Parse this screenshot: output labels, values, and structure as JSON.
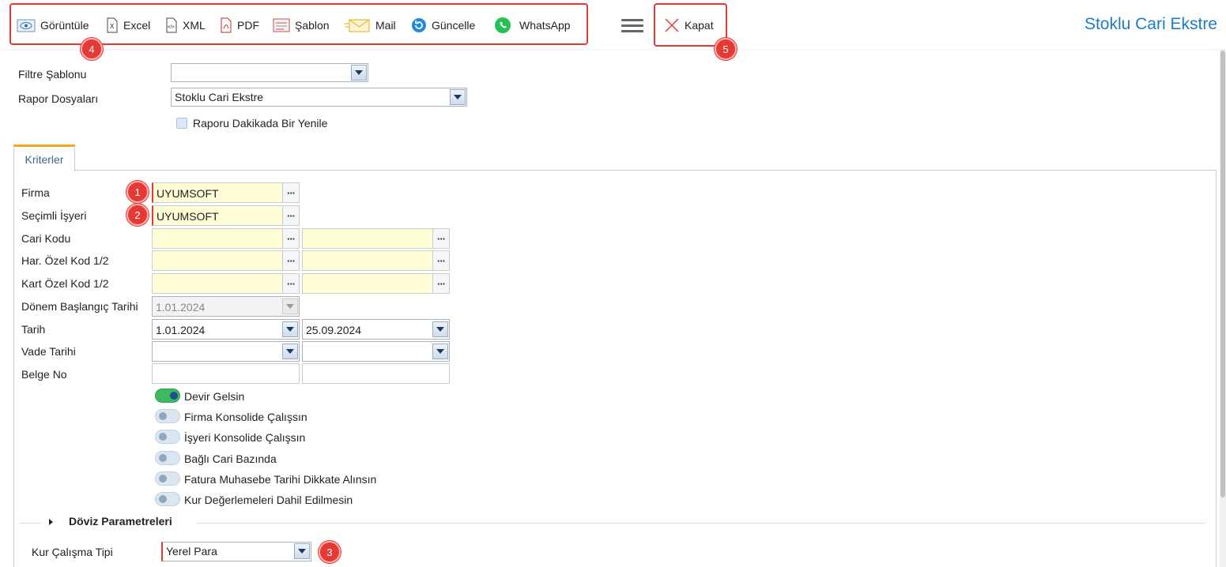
{
  "toolbar": {
    "buttons": [
      {
        "label": "Görüntüle",
        "icon": "view-icon"
      },
      {
        "label": "Excel",
        "icon": "excel-icon"
      },
      {
        "label": "XML",
        "icon": "xml-icon"
      },
      {
        "label": "PDF",
        "icon": "pdf-icon"
      },
      {
        "label": "Şablon",
        "icon": "template-icon"
      },
      {
        "label": "Mail",
        "icon": "mail-icon"
      },
      {
        "label": "Güncelle",
        "icon": "refresh-icon"
      },
      {
        "label": "WhatsApp",
        "icon": "whatsapp-icon"
      }
    ],
    "close_label": "Kapat",
    "page_title": "Stoklu Cari Ekstre"
  },
  "badges": [
    "1",
    "2",
    "3",
    "4",
    "5"
  ],
  "top_form": {
    "filter_template_label": "Filtre Şablonu",
    "filter_template_value": "",
    "report_files_label": "Rapor Dosyaları",
    "report_files_value": "Stoklu Cari Ekstre",
    "refresh_minutely_label": "Raporu Dakikada Bir Yenile"
  },
  "tabs": {
    "criteria": "Kriterler"
  },
  "criteria": {
    "firma_label": "Firma",
    "firma_value": "UYUMSOFT",
    "isyeri_label": "Seçimli İşyeri",
    "isyeri_value": "UYUMSOFT",
    "cari_kodu_label": "Cari Kodu",
    "har_ozel_kod_label": "Har. Özel Kod 1/2",
    "kart_ozel_kod_label": "Kart Özel Kod 1/2",
    "donem_baslangic_label": "Dönem Başlangıç Tarihi",
    "donem_baslangic_value": "1.01.2024",
    "tarih_label": "Tarih",
    "tarih_start": "1.01.2024",
    "tarih_end": "25.09.2024",
    "vade_tarihi_label": "Vade Tarihi",
    "belge_no_label": "Belge No"
  },
  "toggles": [
    {
      "label": "Devir Gelsin",
      "on": true
    },
    {
      "label": "Firma Konsolide Çalışsın",
      "on": false
    },
    {
      "label": "İşyeri Konsolide Çalışsın",
      "on": false
    },
    {
      "label": "Bağlı Cari Bazında",
      "on": false
    },
    {
      "label": "Fatura Muhasebe Tarihi Dikkate Alınsın",
      "on": false
    },
    {
      "label": "Kur Değerlemeleri Dahil Edilmesin",
      "on": false
    }
  ],
  "currency_section": {
    "title": "Döviz Parametreleri",
    "kur_tipi_label": "Kur Çalışma Tipi",
    "kur_tipi_value": "Yerel Para"
  },
  "colors": {
    "accent": "#1e7bc6",
    "highlight": "#e53935",
    "required_bg": "#fffed6",
    "toggle_on": "#3dba5f"
  }
}
